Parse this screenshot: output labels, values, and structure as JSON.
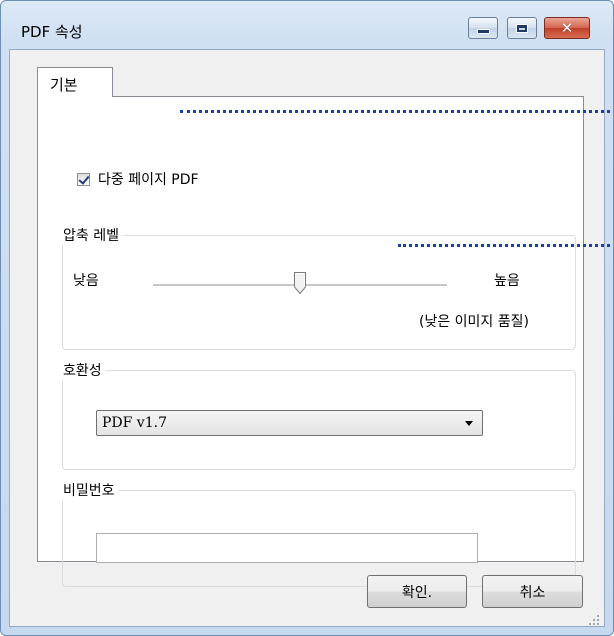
{
  "window": {
    "title": "PDF 속성"
  },
  "tabs": [
    {
      "label": "기본"
    }
  ],
  "options": {
    "multipage_label": "다중 페이지 PDF",
    "multipage_checked": true
  },
  "compression": {
    "title": "압축 레벨",
    "low_label": "낮음",
    "high_label": "높음",
    "quality_note": "(낮은 이미지 품질)",
    "level": 0.5
  },
  "compatibility": {
    "title": "호환성",
    "selected": "PDF v1.7"
  },
  "password": {
    "title": "비밀번호",
    "value": ""
  },
  "buttons": {
    "ok": "확인.",
    "cancel": "취소"
  },
  "colors": {
    "annotation_dots": "#1a3fa8",
    "close_button": "#c7432c"
  }
}
